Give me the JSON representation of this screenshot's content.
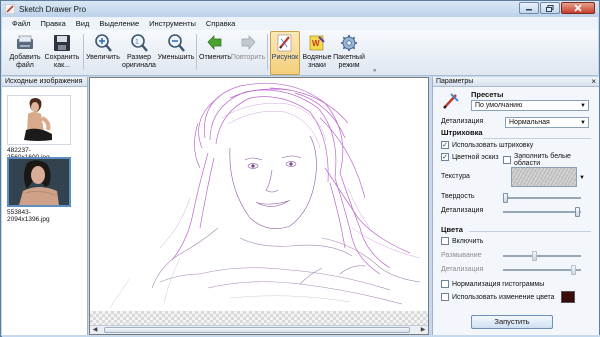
{
  "window": {
    "title": "Sketch Drawer Pro"
  },
  "menu": [
    "Файл",
    "Правка",
    "Вид",
    "Выделение",
    "Инструменты",
    "Справка"
  ],
  "toolbar": {
    "add_file": "Добавить\nфайл",
    "save_as": "Сохранить\nкак...",
    "zoom_in": "Увеличить",
    "original_size": "Размер\nоригинала",
    "zoom_out": "Уменьшить",
    "undo": "Отменить",
    "redo": "Повторить",
    "drawing": "Рисунок",
    "watermarks": "Водяные\nзнаки",
    "batch": "Пакетный\nрежим",
    "overflow": "»"
  },
  "left_panel": {
    "title": "Исходные изображения",
    "images": [
      {
        "name": "482237-2560x1600.jpg",
        "selected": false
      },
      {
        "name": "553843-2094x1396.jpg",
        "selected": true
      }
    ]
  },
  "params": {
    "title": "Параметры",
    "close": "×",
    "presets_label": "Пресеты",
    "presets_value": "По умолчанию",
    "detail_label": "Детализация",
    "detail_value": "Нормальная",
    "hatching": {
      "title": "Штриховка",
      "use_hatching": "Использовать штриховку",
      "use_hatching_checked": true,
      "color_sketch": "Цветной эскиз",
      "color_sketch_checked": true,
      "fill_white": "Заполнить белые области",
      "fill_white_checked": false,
      "texture_label": "Текстура",
      "hardness_label": "Твердость",
      "hardness_value": 0.0,
      "detail_label": "Детализация",
      "detail_value": 1.0
    },
    "colors": {
      "title": "Цвета",
      "enable": "Включить",
      "enable_checked": false,
      "blur_label": "Размывание",
      "blur_value": 0.4,
      "detail_label": "Детализация",
      "detail_value": 0.95,
      "normalize_hist": "Нормализация гистограммы",
      "normalize_hist_checked": false,
      "use_color_change": "Использовать изменение цвета",
      "use_color_change_checked": false,
      "swatch_color": "#3a0d0a"
    },
    "run_button": "Запустить"
  },
  "colors": {
    "sketch_stroke": "#b04ec4",
    "sketch_shadow": "#d29be0"
  }
}
